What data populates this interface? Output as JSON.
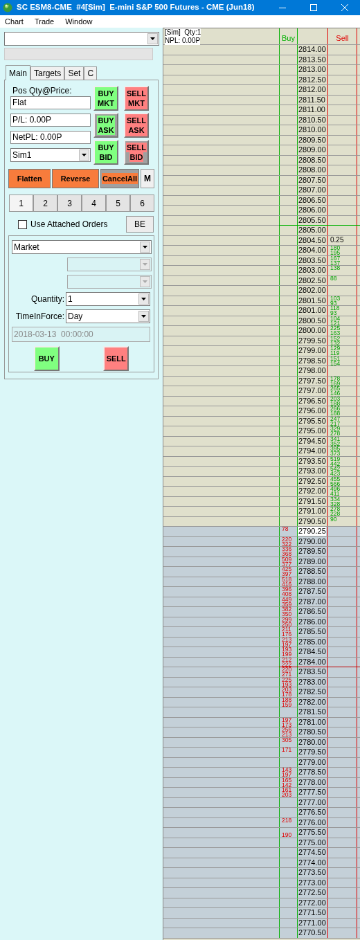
{
  "window": {
    "title": "SC ESM8-CME  #4[Sim]  E-mini S&P 500 Futures - CME (Jun18)"
  },
  "menu": [
    "Chart",
    "Trade",
    "Window"
  ],
  "trade_panel": {
    "tabs": [
      {
        "label": "Main",
        "selected": true
      },
      {
        "label": "Targets",
        "selected": false
      },
      {
        "label": "Set",
        "selected": false
      },
      {
        "label": "C",
        "selected": false
      }
    ],
    "position": {
      "label": "Pos Qty@Price:",
      "value": "Flat",
      "pl": "P/L: 0.00P",
      "net_pl": "NetPL: 0.00P",
      "account": "Sim1"
    },
    "order_buttons": [
      {
        "lines": [
          "BUY",
          "MKT"
        ],
        "color": "#80ff80",
        "kind": "solid"
      },
      {
        "lines": [
          "SELL",
          "MKT"
        ],
        "color": "#ff8080",
        "kind": "solid"
      },
      {
        "lines": [
          "BUY",
          "ASK"
        ],
        "color": "#80ff80",
        "kind": "framed"
      },
      {
        "lines": [
          "SELL",
          "ASK"
        ],
        "color": "#ff8080",
        "kind": "solid"
      },
      {
        "lines": [
          "BUY",
          "BID"
        ],
        "color": "#80ff80",
        "kind": "solid"
      },
      {
        "lines": [
          "SELL",
          "BID"
        ],
        "color": "#ff8080",
        "kind": "framed"
      }
    ],
    "action_buttons": [
      {
        "label": "Flatten",
        "kind": "solid"
      },
      {
        "label": "Reverse",
        "kind": "solid"
      },
      {
        "label": "CancelAll",
        "kind": "framed"
      },
      {
        "label": "M",
        "kind": "plain"
      }
    ],
    "quick_quantity": [
      {
        "label": "1",
        "selected": true
      },
      {
        "label": "2",
        "selected": false
      },
      {
        "label": "3",
        "selected": false
      },
      {
        "label": "4",
        "selected": false
      },
      {
        "label": "5",
        "selected": false
      },
      {
        "label": "6",
        "selected": false
      }
    ],
    "attached_orders": {
      "label": "Use Attached Orders",
      "checked": false
    },
    "be_button": "BE",
    "order_entry": {
      "order_type": "Market",
      "quantity_label": "Quantity:",
      "quantity": "1",
      "tif_label": "TimeInForce:",
      "tif": "Day",
      "date": "2018-03-13  00:00:00",
      "buy": "BUY",
      "sell": "SELL"
    }
  },
  "ladder": {
    "info": [
      "[Sim]  Qty:1",
      "NPL: 0.00P"
    ],
    "buy_header": "Buy",
    "sell_header": "Sell",
    "rows": [
      {
        "price": "2814.00",
        "kind": "ask"
      },
      {
        "price": "2813.50",
        "kind": "ask"
      },
      {
        "price": "2813.00",
        "kind": "ask"
      },
      {
        "price": "2812.50",
        "kind": "ask"
      },
      {
        "price": "2812.00",
        "kind": "ask"
      },
      {
        "price": "2811.50",
        "kind": "ask"
      },
      {
        "price": "2811.00",
        "kind": "ask"
      },
      {
        "price": "2810.50",
        "kind": "ask"
      },
      {
        "price": "2810.00",
        "kind": "ask"
      },
      {
        "price": "2809.50",
        "kind": "ask"
      },
      {
        "price": "2809.00",
        "kind": "ask"
      },
      {
        "price": "2808.50",
        "kind": "ask"
      },
      {
        "price": "2808.00",
        "kind": "ask"
      },
      {
        "price": "2807.50",
        "kind": "ask"
      },
      {
        "price": "2807.00",
        "kind": "ask"
      },
      {
        "price": "2806.50",
        "kind": "ask"
      },
      {
        "price": "2806.00",
        "kind": "ask"
      },
      {
        "price": "2805.50",
        "kind": "ask",
        "marked": true
      },
      {
        "price": "2805.00",
        "kind": "ask"
      },
      {
        "price": "2804.50",
        "kind": "ask",
        "note": "0.25"
      },
      {
        "price": "2804.00",
        "kind": "ask",
        "sell_qty": "180",
        "sell_qty_below": "195"
      },
      {
        "price": "2803.50",
        "kind": "ask",
        "sell_qty": "167",
        "sell_qty_below": "137"
      },
      {
        "price": "2803.00",
        "kind": "ask",
        "sell_qty": "138"
      },
      {
        "price": "2802.50",
        "kind": "ask",
        "sell_qty": "88"
      },
      {
        "price": "2802.00",
        "kind": "ask"
      },
      {
        "price": "2801.50",
        "kind": "ask",
        "sell_qty": "103",
        "sell_qty_below": "93"
      },
      {
        "price": "2801.00",
        "kind": "ask",
        "sell_qty": "118",
        "sell_qty_below": "93"
      },
      {
        "price": "2800.50",
        "kind": "ask",
        "sell_qty": "104",
        "sell_qty_below": "121"
      },
      {
        "price": "2800.00",
        "kind": "ask",
        "sell_qty": "225",
        "sell_qty_below": "163"
      },
      {
        "price": "2799.50",
        "kind": "ask",
        "sell_qty": "152",
        "sell_qty_below": "132"
      },
      {
        "price": "2799.00",
        "kind": "ask",
        "sell_qty": "129",
        "sell_qty_below": "119"
      },
      {
        "price": "2798.50",
        "kind": "ask",
        "sell_qty": "151",
        "sell_qty_below": "154"
      },
      {
        "price": "2798.00",
        "kind": "ask"
      },
      {
        "price": "2797.50",
        "kind": "ask",
        "sell_qty": "178",
        "sell_qty_below": "169"
      },
      {
        "price": "2797.00",
        "kind": "ask",
        "sell_qty": "265",
        "sell_qty_below": "146"
      },
      {
        "price": "2796.50",
        "kind": "ask",
        "sell_qty": "203",
        "sell_qty_below": "188"
      },
      {
        "price": "2796.00",
        "kind": "ask",
        "sell_qty": "266",
        "sell_qty_below": "188"
      },
      {
        "price": "2795.50",
        "kind": "ask",
        "sell_qty": "247",
        "sell_qty_below": "217"
      },
      {
        "price": "2795.00",
        "kind": "ask",
        "sell_qty": "329",
        "sell_qty_below": "278"
      },
      {
        "price": "2794.50",
        "kind": "ask",
        "sell_qty": "341",
        "sell_qty_below": "352"
      },
      {
        "price": "2794.00",
        "kind": "ask",
        "sell_qty": "395",
        "sell_qty_below": "373"
      },
      {
        "price": "2793.50",
        "kind": "ask",
        "sell_qty": "519",
        "sell_qty_below": "442"
      },
      {
        "price": "2793.00",
        "kind": "ask",
        "sell_qty": "542",
        "sell_qty_below": "423"
      },
      {
        "price": "2792.50",
        "kind": "ask",
        "sell_qty": "455",
        "sell_qty_below": "566"
      },
      {
        "price": "2792.00",
        "kind": "ask",
        "sell_qty": "496",
        "sell_qty_below": "411"
      },
      {
        "price": "2791.50",
        "kind": "ask",
        "sell_qty": "334",
        "sell_qty_below": "328"
      },
      {
        "price": "2791.00",
        "kind": "ask",
        "sell_qty": "278",
        "sell_qty_below": "228"
      },
      {
        "price": "2790.50",
        "kind": "ask",
        "sell_qty": "90"
      },
      {
        "price": "2790.25",
        "kind": "last",
        "buy_qty": "78"
      },
      {
        "price": "2790.00",
        "kind": "bid",
        "buy_qty": "220",
        "buy_qty_below": "322"
      },
      {
        "price": "2789.50",
        "kind": "bid",
        "buy_qty": "336",
        "buy_qty_below": "368"
      },
      {
        "price": "2789.00",
        "kind": "bid",
        "buy_qty": "509",
        "buy_qty_below": "377"
      },
      {
        "price": "2788.50",
        "kind": "bid",
        "buy_qty": "425",
        "buy_qty_below": "397"
      },
      {
        "price": "2788.00",
        "kind": "bid",
        "buy_qty": "518",
        "buy_qty_below": "416"
      },
      {
        "price": "2787.50",
        "kind": "bid",
        "buy_qty": "396",
        "buy_qty_below": "408"
      },
      {
        "price": "2787.00",
        "kind": "bid",
        "buy_qty": "449",
        "buy_qty_below": "359"
      },
      {
        "price": "2786.50",
        "kind": "bid",
        "buy_qty": "382",
        "buy_qty_below": "350"
      },
      {
        "price": "2786.00",
        "kind": "bid",
        "buy_qty": "299",
        "buy_qty_below": "250"
      },
      {
        "price": "2785.50",
        "kind": "bid",
        "buy_qty": "211",
        "buy_qty_below": "176"
      },
      {
        "price": "2785.00",
        "kind": "bid",
        "buy_qty": "213",
        "buy_qty_below": "197"
      },
      {
        "price": "2784.50",
        "kind": "bid",
        "buy_qty": "193",
        "buy_qty_below": "199"
      },
      {
        "price": "2784.00",
        "kind": "bid",
        "buy_qty": "212",
        "buy_qty_below": "222"
      },
      {
        "price": "2783.50",
        "kind": "bid",
        "buy_qty": "220",
        "buy_qty_below": "271",
        "marked": true
      },
      {
        "price": "2783.00",
        "kind": "bid",
        "buy_qty": "225",
        "buy_qty_below": "193"
      },
      {
        "price": "2782.50",
        "kind": "bid",
        "buy_qty": "203",
        "buy_qty_below": "178"
      },
      {
        "price": "2782.00",
        "kind": "bid",
        "buy_qty": "188",
        "buy_qty_below": "159"
      },
      {
        "price": "2781.50",
        "kind": "bid"
      },
      {
        "price": "2781.00",
        "kind": "bid",
        "buy_qty": "197",
        "buy_qty_below": "173"
      },
      {
        "price": "2780.50",
        "kind": "bid",
        "buy_qty": "256",
        "buy_qty_below": "213"
      },
      {
        "price": "2780.00",
        "kind": "bid",
        "buy_qty": "305"
      },
      {
        "price": "2779.50",
        "kind": "bid",
        "buy_qty": "171"
      },
      {
        "price": "2779.00",
        "kind": "bid"
      },
      {
        "price": "2778.50",
        "kind": "bid",
        "buy_qty": "143",
        "buy_qty_below": "197"
      },
      {
        "price": "2778.00",
        "kind": "bid",
        "buy_qty": "165",
        "buy_qty_below": "142"
      },
      {
        "price": "2777.50",
        "kind": "bid",
        "buy_qty": "161",
        "buy_qty_below": "203"
      },
      {
        "price": "2777.00",
        "kind": "bid"
      },
      {
        "price": "2776.50",
        "kind": "bid"
      },
      {
        "price": "2776.00",
        "kind": "bid",
        "buy_qty": "218"
      },
      {
        "price": "2775.50",
        "kind": "bid",
        "buy_qty_below": "190"
      },
      {
        "price": "2775.00",
        "kind": "bid"
      },
      {
        "price": "2774.50",
        "kind": "bid"
      },
      {
        "price": "2774.00",
        "kind": "bid"
      },
      {
        "price": "2773.50",
        "kind": "bid"
      },
      {
        "price": "2773.00",
        "kind": "bid"
      },
      {
        "price": "2772.50",
        "kind": "bid"
      },
      {
        "price": "2772.00",
        "kind": "bid"
      },
      {
        "price": "2771.50",
        "kind": "bid"
      },
      {
        "price": "2771.00",
        "kind": "bid"
      },
      {
        "price": "2770.50",
        "kind": "bid"
      }
    ]
  }
}
